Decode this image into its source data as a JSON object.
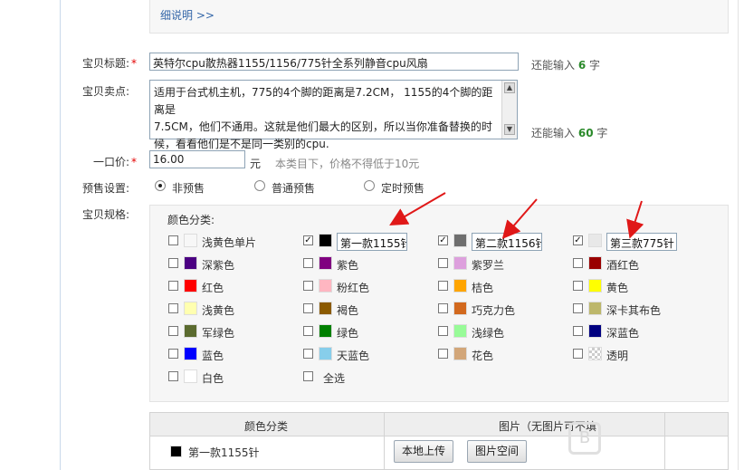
{
  "top": {
    "detail_link": "细说明 >>"
  },
  "title_field": {
    "label": "宝贝标题:",
    "required": "*",
    "value": "英特尔cpu散热器1155/1156/775针全系列静音cpu风扇",
    "hint_prefix": "还能输入",
    "hint_count": "6",
    "hint_suffix": "字"
  },
  "selling_point": {
    "label": "宝贝卖点:",
    "lines": [
      "适用于台式机主机，775的4个脚的距离是7.2CM， 1155的4个脚的距离是",
      "7.5CM，他们不通用。这就是他们最大的区别，所以当你准备替换的时",
      "候，看看他们是不是同一类别的cpu."
    ],
    "hint_prefix": "还能输入",
    "hint_count": "60",
    "hint_suffix": "字"
  },
  "price": {
    "label": "一口价:",
    "required": "*",
    "value": "16.00",
    "unit": "元",
    "note": "本类目下，价格不得低于10元"
  },
  "presale": {
    "label": "预售设置:",
    "options": [
      "非预售",
      "普通预售",
      "定时预售"
    ],
    "selected": "非预售"
  },
  "spec": {
    "label": "宝贝规格:",
    "color_title": "颜色分类:",
    "colors": [
      {
        "name": "浅黄色单片",
        "color": "#f7f7f7",
        "checked": false
      },
      {
        "name": "",
        "color": "#000000",
        "checked": true,
        "custom": "第一款1155针"
      },
      {
        "name": "",
        "color": "#6e6e6e",
        "checked": true,
        "custom": "第二款1156针"
      },
      {
        "name": "",
        "color": "#e8e8e8",
        "checked": true,
        "custom": "第三款775针"
      },
      {
        "name": "深紫色",
        "color": "#4b0082",
        "checked": false
      },
      {
        "name": "紫色",
        "color": "#800080",
        "checked": false
      },
      {
        "name": "紫罗兰",
        "color": "#dda0dd",
        "checked": false
      },
      {
        "name": "酒红色",
        "color": "#990000",
        "checked": false
      },
      {
        "name": "红色",
        "color": "#ff0000",
        "checked": false
      },
      {
        "name": "粉红色",
        "color": "#ffb6c1",
        "checked": false
      },
      {
        "name": "桔色",
        "color": "#ffa500",
        "checked": false
      },
      {
        "name": "黄色",
        "color": "#ffff00",
        "checked": false
      },
      {
        "name": "浅黄色",
        "color": "#ffffb0",
        "checked": false
      },
      {
        "name": "褐色",
        "color": "#8b5a00",
        "checked": false
      },
      {
        "name": "巧克力色",
        "color": "#d2691e",
        "checked": false
      },
      {
        "name": "深卡其布色",
        "color": "#bdb76b",
        "checked": false
      },
      {
        "name": "军绿色",
        "color": "#5b6b2f",
        "checked": false
      },
      {
        "name": "绿色",
        "color": "#008000",
        "checked": false
      },
      {
        "name": "浅绿色",
        "color": "#98fb98",
        "checked": false
      },
      {
        "name": "深蓝色",
        "color": "#000080",
        "checked": false
      },
      {
        "name": "蓝色",
        "color": "#0000ff",
        "checked": false
      },
      {
        "name": "天蓝色",
        "color": "#87ceeb",
        "checked": false
      },
      {
        "name": "花色",
        "color": "#d2a679",
        "checked": false
      },
      {
        "name": "透明",
        "color": "transparent",
        "checked": false
      },
      {
        "name": "白色",
        "color": "#ffffff",
        "checked": false
      },
      {
        "name": "全选",
        "color": null,
        "checked": false
      }
    ]
  },
  "table": {
    "headers": [
      "颜色分类",
      "图片（无图片可不填"
    ],
    "rows": [
      {
        "color": "#000000",
        "name": "第一款1155针",
        "upload_label": "本地上传",
        "space_label": "图片空间"
      }
    ]
  },
  "accent_arrow_color": "#e01818"
}
